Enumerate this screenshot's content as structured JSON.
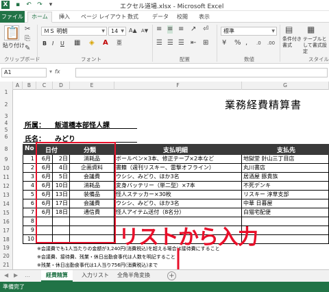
{
  "window": {
    "title": "エクセル道場.xlsx - Microsoft Excel"
  },
  "ribbon_tabs": [
    "ファイル",
    "ホーム",
    "挿入",
    "ページ レイアウト",
    "数式",
    "データ",
    "校閲",
    "表示"
  ],
  "ribbon": {
    "clipboard": {
      "paste": "貼り付け",
      "label": "クリップボード"
    },
    "font": {
      "name": "ＭＳ 明朝",
      "size": "14",
      "label": "フォント",
      "bold": "B",
      "italic": "I",
      "underline": "U"
    },
    "alignment": {
      "label": "配置"
    },
    "number": {
      "format": "標準",
      "label": "数値"
    },
    "styles": {
      "conditional": "条件付き書式",
      "table": "テーブルとして書式設定",
      "label": "スタイル"
    }
  },
  "formula_bar": {
    "name_box": "A1",
    "fx": "fx"
  },
  "columns": [
    "A",
    "B",
    "C",
    "D",
    "E",
    "F",
    "G"
  ],
  "rows": [
    "1",
    "2",
    "3",
    "4",
    "5",
    "6",
    "7",
    "8",
    "9",
    "10",
    "11",
    "12",
    "13",
    "14",
    "15",
    "16",
    "17",
    "18",
    "19",
    "20",
    "21"
  ],
  "sheet": {
    "title": "業務経費精算書",
    "affiliation_label": "所属：",
    "affiliation_value": "飯道橋本部怪人課",
    "name_label": "氏名：",
    "name_value": "みどり",
    "headers": [
      "No",
      "日付",
      "分類",
      "支払明細",
      "支払先"
    ],
    "rows": [
      {
        "no": "1",
        "month": "6月",
        "day": "2日",
        "category": "消耗品",
        "detail": "ボールペン×3本、修正テープ×2本など",
        "payee": "地獄堂 針山三丁目店"
      },
      {
        "no": "2",
        "month": "6月",
        "day": "4日",
        "category": "企画資料",
        "detail": "書籍（週刊リスキー、雷撃オフライン）",
        "payee": "丸川書店"
      },
      {
        "no": "3",
        "month": "6月",
        "day": "5日",
        "category": "会議費",
        "detail": "ウシシ、みどり、ほか3名",
        "payee": "居酒屋 豚貴族"
      },
      {
        "no": "4",
        "month": "6月",
        "day": "10日",
        "category": "消耗品",
        "detail": "変身バッテリー（単二型）×7本",
        "payee": "不死デンキ"
      },
      {
        "no": "5",
        "month": "6月",
        "day": "13日",
        "category": "装備品",
        "detail": "怪人ステッカー×30枚",
        "payee": "リスキー 淳草支部"
      },
      {
        "no": "6",
        "month": "6月",
        "day": "17日",
        "category": "会議費",
        "detail": "ウシシ、みどり、ほか3名",
        "payee": "中華 日暮屋"
      },
      {
        "no": "7",
        "month": "6月",
        "day": "18日",
        "category": "通信費",
        "detail": "怪人アイテム送付（8名分）",
        "payee": "白猫宅配便"
      },
      {
        "no": "8",
        "month": "",
        "day": "",
        "category": "",
        "detail": "",
        "payee": ""
      },
      {
        "no": "9",
        "month": "",
        "day": "",
        "category": "",
        "detail": "",
        "payee": ""
      },
      {
        "no": "10",
        "month": "",
        "day": "",
        "category": "",
        "detail": "",
        "payee": ""
      }
    ],
    "notes": [
      "※会議費でも1人当たりの金額が3,240円(消費税込)を超える場合は接待費にすること",
      "※会議費、接待費、残業・休日出勤食事代は人数を明記すること",
      "※残業・休日出勤食事代は1人当り756円(消費税込)まで"
    ]
  },
  "overlay": {
    "label": "リストから入力",
    "color": "#e8102a"
  },
  "sheet_tabs": [
    "経費精算",
    "入力リスト",
    "全角半角変換"
  ],
  "status": {
    "text": "準備完了"
  },
  "colors": {
    "accent": "#217346",
    "annotation": "#e8102a"
  }
}
